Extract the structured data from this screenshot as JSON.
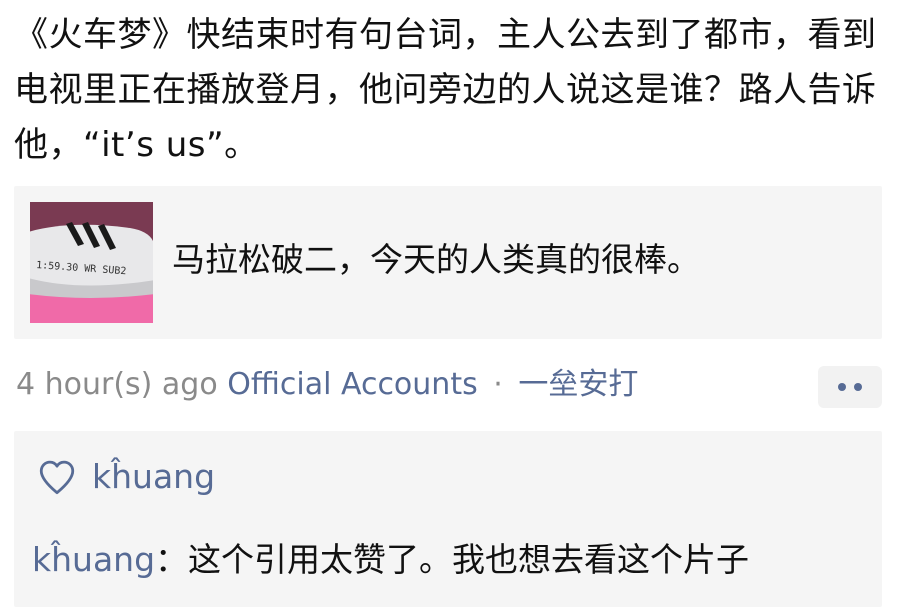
{
  "post": {
    "text": "《火车梦》快结束时有句台词，主人公去到了都市，看到电视里正在播放登月，他问旁边的人说这是谁？路人告诉他，“it’s us”。"
  },
  "share_card": {
    "title": "马拉松破二，今天的人类真的很棒。",
    "thumbnail": {
      "description_icon": "shoe-thumbnail",
      "handwriting": "1:59.30 WR SUB2",
      "colors": {
        "background": "#e23b9c",
        "shoe": "#e8e8ea",
        "stripes": "#1a1a1a"
      }
    }
  },
  "meta": {
    "time": "4 hour(s) ago",
    "source": "Official Accounts",
    "separator": "·",
    "action": "一垒安打"
  },
  "more_button": {
    "icon": "more-dots-icon"
  },
  "likes": {
    "icon": "heart-icon",
    "names": "kĥuang"
  },
  "comments": [
    {
      "author": "kĥuang",
      "separator": "：",
      "text": "这个引用太赞了。我也想去看这个片子"
    }
  ],
  "colors": {
    "link": "#576b95",
    "muted": "#8a8a8a",
    "card_bg": "#f5f5f5",
    "text": "#111111"
  }
}
